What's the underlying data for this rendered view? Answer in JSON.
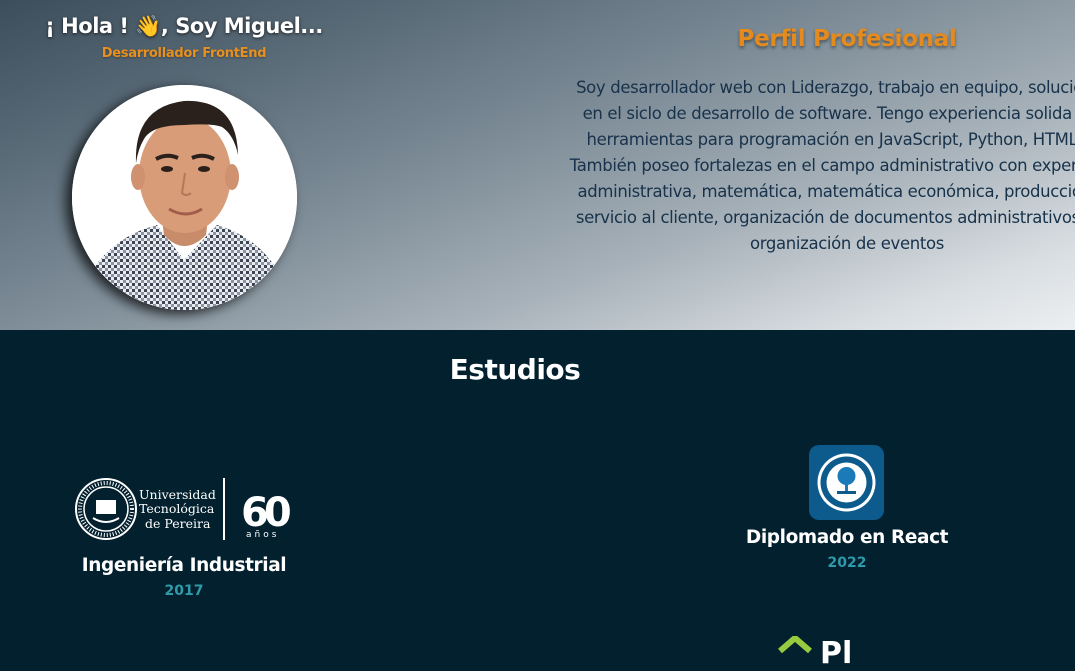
{
  "hero": {
    "greeting": "¡ Hola ! 👋, Soy Miguel...",
    "role": "Desarrollador FrontEnd",
    "profile_title": "Perfil Profesional",
    "profile_lines": [
      "Soy desarrollador web con Liderazgo, trabajo en equipo, solución de",
      "en el siclo de desarrollo de software. Tengo experiencia solida en e",
      "herramientas para programación en JavaScript, Python, HTML y A",
      "También poseo fortalezas en el campo administrativo con experiencia",
      "administrativa, matemática, matemática económica, producción do",
      "servicio al cliente, organización de documentos administrativos, con",
      "organización de eventos"
    ]
  },
  "studies": {
    "title": "Estudios",
    "items": [
      {
        "logo_lines": [
          "Universidad",
          "Tecnológica",
          "de Pereira"
        ],
        "logo_badge": "60",
        "logo_badge_sub": "años",
        "title": "Ingeniería Industrial",
        "year": "2017"
      },
      {
        "title": "Diplomado en React",
        "year": "2022"
      }
    ],
    "partial_text": "Pl"
  },
  "colors": {
    "accent_orange": "#e58b1d",
    "year_teal": "#2f9aaa",
    "dark_bg": "#03202e"
  }
}
